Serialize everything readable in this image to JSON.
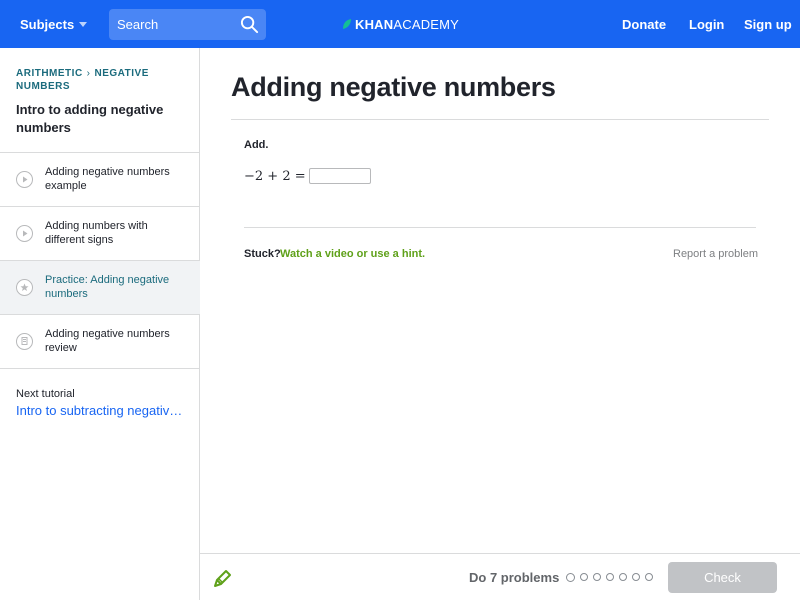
{
  "header": {
    "subjects_label": "Subjects",
    "search_placeholder": "Search",
    "logo_bold": "KHAN",
    "logo_light": "ACADEMY",
    "donate_label": "Donate",
    "login_label": "Login",
    "signup_label": "Sign up"
  },
  "sidebar": {
    "breadcrumb": [
      "ARITHMETIC",
      "NEGATIVE NUMBERS"
    ],
    "tutorial_title": "Intro to adding negative numbers",
    "items": [
      {
        "label": "Adding negative numbers example",
        "icon": "play-icon",
        "active": false
      },
      {
        "label": "Adding numbers with different signs",
        "icon": "play-icon",
        "active": false
      },
      {
        "label": "Practice: Adding negative numbers",
        "icon": "star-icon",
        "active": true
      },
      {
        "label": "Adding negative numbers review",
        "icon": "article-icon",
        "active": false
      }
    ],
    "next_tutorial_label": "Next tutorial",
    "next_tutorial_link": "Intro to subtracting negative numbers"
  },
  "main": {
    "title": "Adding negative numbers",
    "prompt": "Add.",
    "equation_lhs": "−2 + 2 =",
    "answer_value": "",
    "stuck_label": "Stuck?",
    "hint_link": "Watch a video or use a hint.",
    "report_link": "Report a problem"
  },
  "footer": {
    "do_problems": "Do 7 problems",
    "problem_count": 7,
    "current_problem": 1,
    "check_label": "Check"
  },
  "colors": {
    "header_bg": "#1865f2",
    "link_teal": "#1b6b7d",
    "hint_green": "#5fa11a",
    "check_disabled": "#c1c3c6"
  }
}
